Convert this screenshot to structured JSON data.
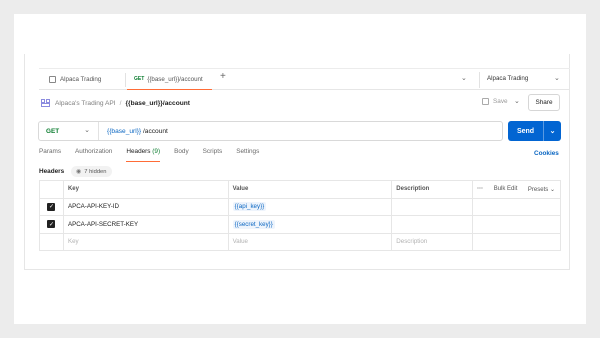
{
  "tabs": [
    {
      "label": "Alpaca Trading"
    },
    {
      "method": "GET",
      "label": "{{base_url}}/account"
    }
  ],
  "environment": "Alpaca Trading",
  "breadcrumb": {
    "parent": "Alpaca's Trading API",
    "separator": "/",
    "current": "{{base_url}}/account"
  },
  "toolbar": {
    "save_label": "Save",
    "share_label": "Share"
  },
  "request": {
    "method": "GET",
    "url_var": "{{base_url}}",
    "url_path": " /account"
  },
  "send_label": "Send",
  "subtabs": {
    "params": "Params",
    "authorization": "Authorization",
    "headers": "Headers",
    "headers_count": "(9)",
    "body": "Body",
    "scripts": "Scripts",
    "settings": "Settings"
  },
  "cookies_label": "Cookies",
  "headers_section": {
    "title": "Headers",
    "hidden": "7 hidden"
  },
  "table": {
    "columns": {
      "key": "Key",
      "value": "Value",
      "description": "Description",
      "bulk_edit": "Bulk Edit",
      "presets": "Presets"
    },
    "rows": [
      {
        "key": "APCA-API-KEY-ID",
        "value": "{{api_key}}",
        "checked": true
      },
      {
        "key": "APCA-API-SECRET-KEY",
        "value": "{{secret_key}}",
        "checked": true
      }
    ],
    "placeholder": {
      "key": "Key",
      "value": "Value",
      "description": "Description"
    }
  },
  "icons": {
    "tab": "collection-tab-icon",
    "plus": "plus-icon",
    "chevron": "chevron-down-icon",
    "api": "api-icon",
    "save": "save-icon",
    "eye": "eye-icon",
    "more": "more-horizontal-icon",
    "check": "checkbox-checked-icon"
  },
  "colors": {
    "accent": "#ff6c37",
    "send": "#0265d2",
    "get": "#0b7c2f",
    "variable": "#0a66c2"
  }
}
